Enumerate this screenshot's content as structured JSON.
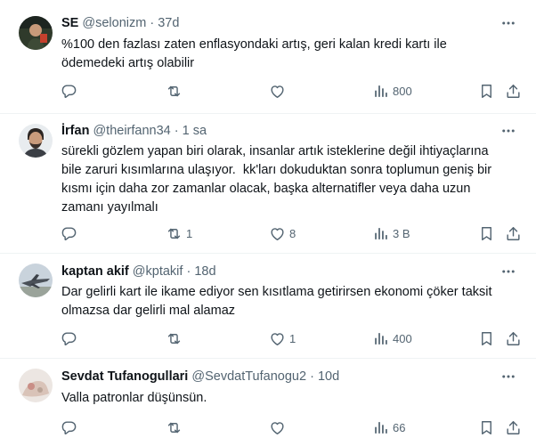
{
  "tweets": [
    {
      "name": "SE",
      "handle": "@selonizm",
      "dot": "·",
      "time": "37d",
      "text": "%100 den fazlası zaten enflasyondaki artış, geri kalan kredi kartı ile\nödemedeki artış olabilir",
      "replies": "",
      "retweets": "",
      "likes": "",
      "views": "800"
    },
    {
      "name": "İrfan",
      "handle": "@theirfann34",
      "dot": "·",
      "time": "1 sa",
      "text": "sürekli gözlem yapan biri olarak, insanlar artık isteklerine değil ihtiyaçlarına\nbile zaruri kısımlarına ulaşıyor.  kk'ları dokuduktan sonra toplumun geniş bir\nkısmı için daha zor zamanlar olacak, başka alternatifler veya daha uzun\nzamanı yayılmalı",
      "replies": "",
      "retweets": "1",
      "likes": "8",
      "views": "3 B"
    },
    {
      "name": "kaptan akif",
      "handle": "@kptakif",
      "dot": "·",
      "time": "18d",
      "text": "Dar gelirli kart ile ikame ediyor sen kısıtlama getirirsen ekonomi çöker taksit\nolmazsa dar gelirli mal alamaz",
      "replies": "",
      "retweets": "",
      "likes": "1",
      "views": "400"
    },
    {
      "name": "Sevdat Tufanogullari",
      "handle": "@SevdatTufanogu2",
      "dot": "·",
      "time": "10d",
      "text": "Valla patronlar düşünsün.",
      "replies": "",
      "retweets": "",
      "likes": "",
      "views": "66"
    }
  ],
  "icons": {
    "more": "more-dots-icon",
    "reply": "reply-icon",
    "retweet": "retweet-icon",
    "like": "heart-icon",
    "views": "views-chart-icon",
    "bookmark": "bookmark-icon",
    "share": "share-icon"
  },
  "colors": {
    "text": "#0f1419",
    "secondary": "#536471",
    "divider": "#eff3f4"
  }
}
